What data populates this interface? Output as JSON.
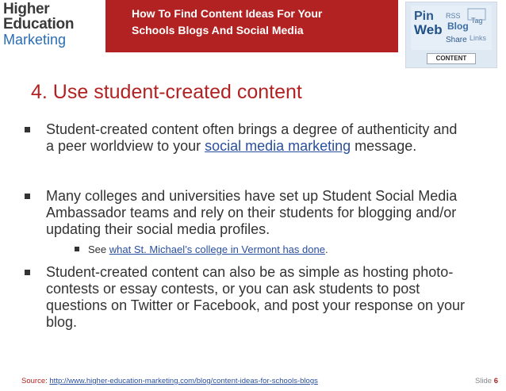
{
  "header": {
    "logo": {
      "line1": "Higher",
      "line2": "Education",
      "line3": "Marketing"
    },
    "title_line1": "How To Find Content Ideas For Your",
    "title_line2": "Schools Blogs And Social Media",
    "image_tag": "CONTENT",
    "image_words": [
      "Pin",
      "Web",
      "RSS",
      "Blog",
      "Tag",
      "Share",
      "Links"
    ]
  },
  "heading": "4. Use student-created content",
  "bullets": [
    {
      "pre": "Student-created content often brings a degree of authenticity and a peer worldview to your ",
      "link": "social media marketing",
      "post": " message."
    },
    {
      "text": "Many colleges and universities have set up Student Social Media Ambassador teams and rely on their students for blogging and/or updating their social media profiles."
    },
    {
      "text": "Student-created content can also be as simple as hosting photo-contests or essay contests, or you can ask students to post questions on Twitter or Facebook, and post your response on your blog."
    }
  ],
  "sub_bullet": {
    "pre": "See ",
    "link": "what St. Michael’s college in Vermont has done",
    "post": "."
  },
  "footer": {
    "source_label": "Source:",
    "source_url": "http://www.higher-education-marketing.com/blog/content-ideas-for-schools-blogs",
    "slide_label": "Slide",
    "slide_number": "6"
  },
  "colors": {
    "accent": "#b22222",
    "link": "#2a4f9e",
    "text": "#333333"
  }
}
